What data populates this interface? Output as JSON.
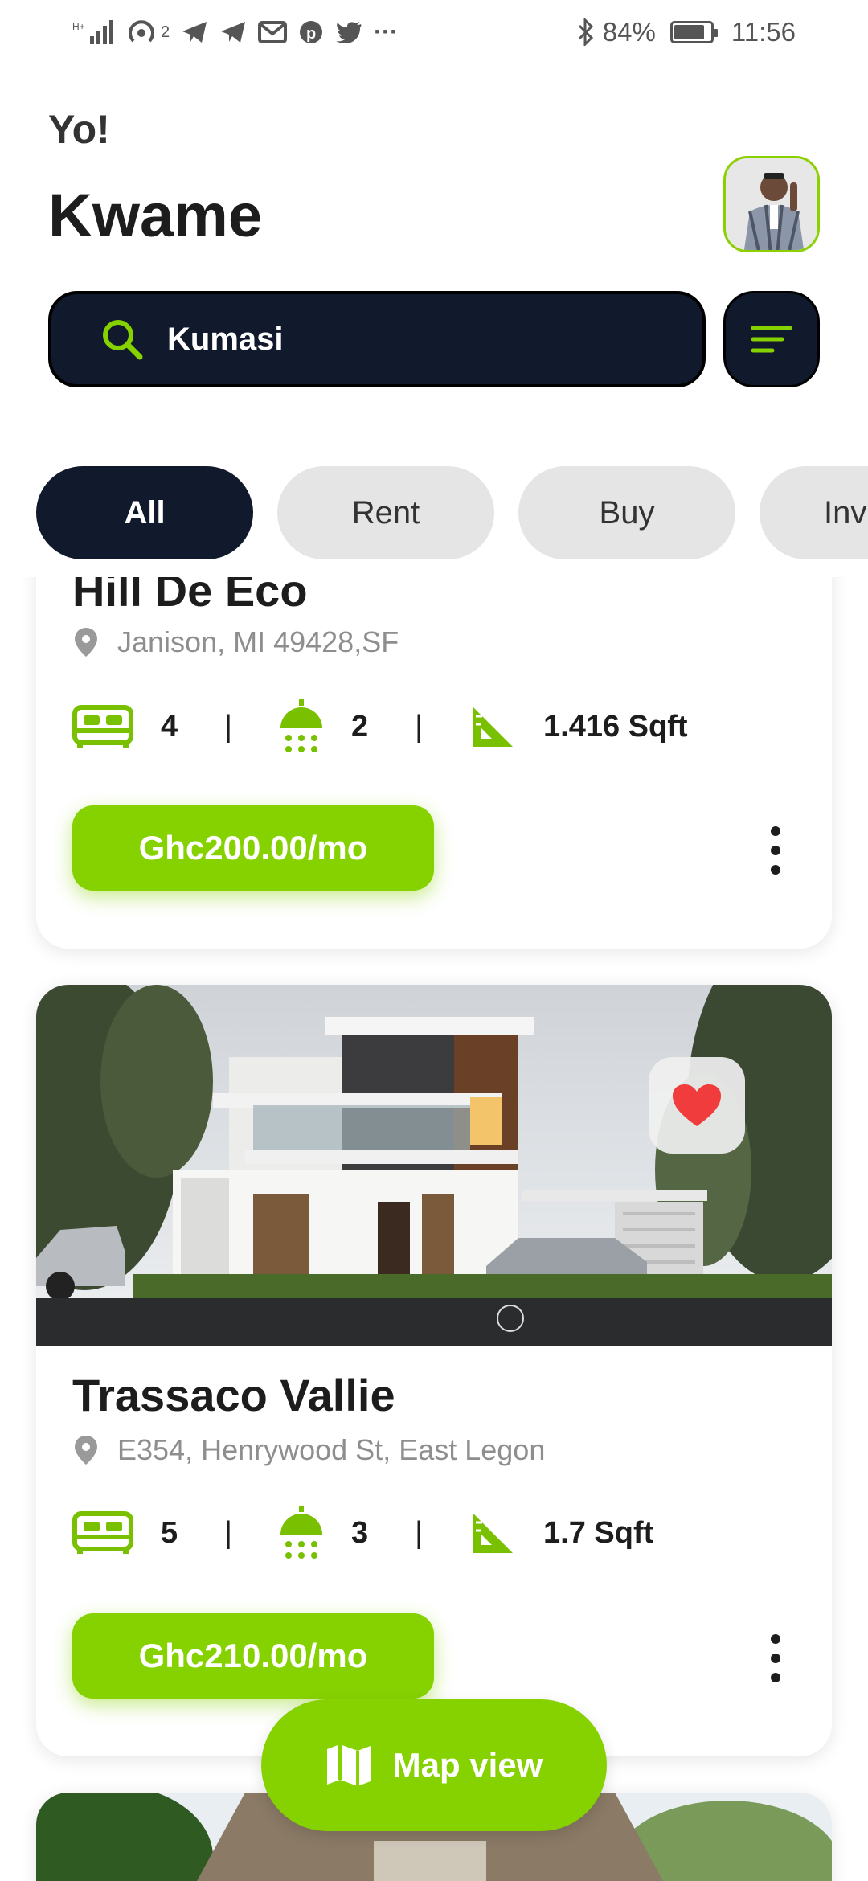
{
  "status_bar": {
    "superscript": "2",
    "battery": "84%",
    "battery_level": 0.84,
    "time": "11:56",
    "icons": [
      "signal-icon",
      "hotspot-icon",
      "telegram-icon",
      "telegram-icon",
      "gmail-icon",
      "pinterest-icon",
      "twitter-icon",
      "more-icon",
      "bluetooth-icon",
      "battery-icon"
    ]
  },
  "header": {
    "greeting": "Yo!",
    "name": "Kwame"
  },
  "search": {
    "value": "Kumasi"
  },
  "tabs": [
    {
      "label": "All",
      "active": true
    },
    {
      "label": "Rent",
      "active": false
    },
    {
      "label": "Buy",
      "active": false
    },
    {
      "label": "Inv",
      "active": false
    }
  ],
  "listings": [
    {
      "title": "Hill De Eco",
      "address": "Janison, MI 49428,SF",
      "beds": "4",
      "baths": "2",
      "area": "1.416 Sqft",
      "price": "Ghc200.00/mo"
    },
    {
      "title": "Trassaco Vallie",
      "address": "E354, Henrywood St, East Legon",
      "beds": "5",
      "baths": "3",
      "area": "1.7 Sqft",
      "price": "Ghc210.00/mo",
      "favorited": true
    }
  ],
  "map_button": {
    "label": "Map view"
  },
  "colors": {
    "accent": "#86d100",
    "dark": "#111a2c",
    "favorite": "#f03c3c"
  }
}
